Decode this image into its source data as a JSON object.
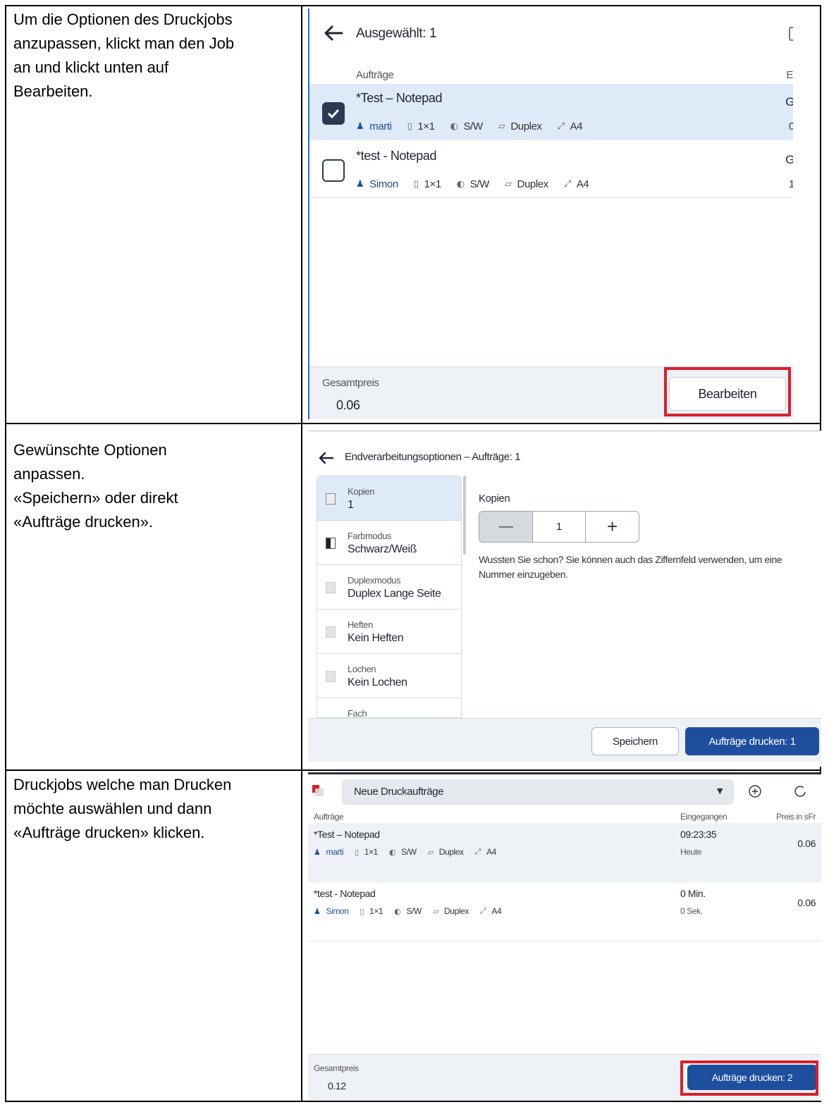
{
  "rows": [
    {
      "instruction": [
        "Um die Optionen des Druckjobs",
        "anzupassen, klickt man den Job",
        "an und klickt unten auf",
        "Bearbeiten."
      ]
    },
    {
      "instruction": [
        "Gewünschte Optionen",
        "anpassen.",
        "«Speichern» oder direkt",
        "«Aufträge drucken»."
      ]
    },
    {
      "instruction": [
        "Druckjobs welche man Drucken",
        "möchte auswählen und dann",
        "«Aufträge drucken» klicken."
      ]
    }
  ],
  "screen1": {
    "header": "Ausgewählt: 1",
    "column_jobs": "Aufträge",
    "column_cut": "E",
    "jobs": [
      {
        "title": "*Test – Notepad",
        "user": "marti",
        "copies": "1×1",
        "color": "S/W",
        "duplex": "Duplex",
        "size": "A4",
        "right_top": "G",
        "right_bottom": "0",
        "selected": true
      },
      {
        "title": "*test - Notepad",
        "user": "Simon",
        "copies": "1×1",
        "color": "S/W",
        "duplex": "Duplex",
        "size": "A4",
        "right_top": "G",
        "right_bottom": "1",
        "selected": false
      }
    ],
    "total_label": "Gesamtpreis",
    "total_value": "0.06",
    "edit_button": "Bearbeiten"
  },
  "screen2": {
    "header": "Endverarbeitungsoptionen – Aufträge: 1",
    "options": [
      {
        "label": "Kopien",
        "value": "1"
      },
      {
        "label": "Farbmodus",
        "value": "Schwarz/Weiß"
      },
      {
        "label": "Duplexmodus",
        "value": "Duplex Lange Seite"
      },
      {
        "label": "Heften",
        "value": "Kein Heften"
      },
      {
        "label": "Lochen",
        "value": "Kein Lochen"
      },
      {
        "label": "Fach",
        "value": ""
      }
    ],
    "detail_title": "Kopien",
    "stepper_value": "1",
    "minus": "—",
    "plus": "+",
    "hint_line1": "Wussten Sie schon? Sie können auch das Ziffernfeld verwenden, um eine",
    "hint_line2": "Nummer einzugeben.",
    "save_button": "Speichern",
    "print_button": "Aufträge drucken: 1"
  },
  "screen3": {
    "dropdown": "Neue Druckaufträge",
    "col_jobs": "Aufträge",
    "col_received": "Eingegangen",
    "col_price": "Preis in sFr",
    "jobs": [
      {
        "title": "*Test – Notepad",
        "user": "marti",
        "copies": "1×1",
        "color": "S/W",
        "duplex": "Duplex",
        "size": "A4",
        "received_top": "09:23:35",
        "received_bottom": "Heute",
        "price": "0.06"
      },
      {
        "title": "*test - Notepad",
        "user": "Simon",
        "copies": "1×1",
        "color": "S/W",
        "duplex": "Duplex",
        "size": "A4",
        "received_top": "0 Min.",
        "received_bottom": "0 Sek.",
        "price": "0.06"
      }
    ],
    "total_label": "Gesamtpreis",
    "total_value": "0.12",
    "print_button": "Aufträge drucken: 2"
  },
  "colors": {
    "accent": "#1e4e9e",
    "highlight_red": "#d7202a",
    "selected_row": "#dfeaf8",
    "footer": "#eef1f5"
  }
}
